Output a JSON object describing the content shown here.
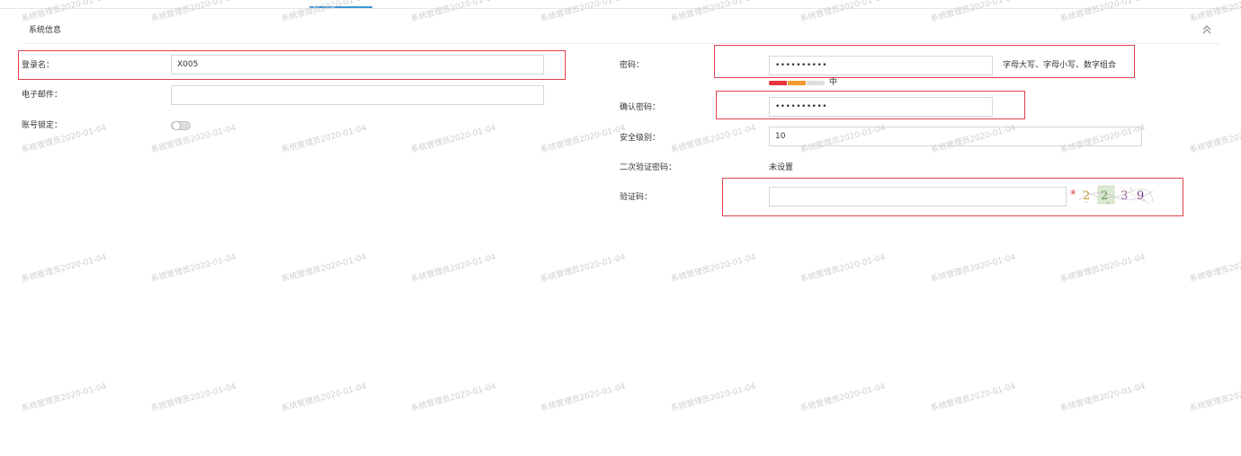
{
  "section": {
    "title": "系统信息"
  },
  "left": {
    "login_label": "登录名：",
    "login_value": "X005",
    "email_label": "电子邮件：",
    "email_value": "",
    "lock_label": "账号锁定：",
    "lock_state": false
  },
  "right": {
    "password_label": "密码：",
    "password_value": "••••••••••",
    "password_hint": "字母大写、字母小写、数字组合",
    "strength_label": "中",
    "confirm_label": "确认密码：",
    "confirm_value": "••••••••••",
    "security_level_label": "安全级别：",
    "security_level_value": "10",
    "twofa_label": "二次验证密码：",
    "twofa_value": "未设置",
    "captcha_label": "验证码：",
    "captcha_value": "",
    "required_mark": "*",
    "captcha_text": "2239"
  },
  "watermark": {
    "text": "系统管理员2020-01-04"
  },
  "colors": {
    "highlight_border": "#e0424b",
    "active_tab": "#3b95d8",
    "strength_weak": "#e8333d",
    "strength_medium": "#f39b2e",
    "strength_empty": "#dddddd"
  },
  "icons": {
    "collapse": "double-chevron-up-icon"
  }
}
